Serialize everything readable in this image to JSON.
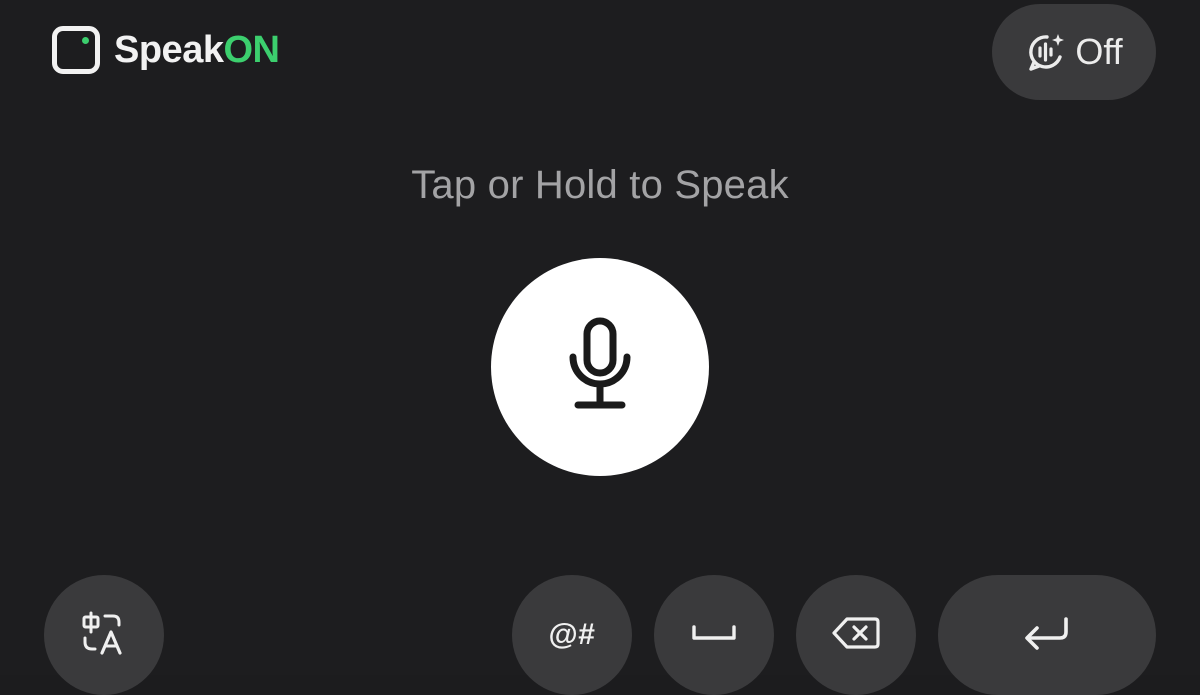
{
  "header": {
    "brand": {
      "name_part1": "Speak",
      "name_part2": "ON",
      "accent_color": "#3ccf6e",
      "logo_icon": "rounded-square-logo-icon"
    },
    "toggle": {
      "icon": "voice-assist-icon",
      "label": "Off"
    }
  },
  "main": {
    "prompt": "Tap or Hold to Speak",
    "mic_icon": "microphone-icon"
  },
  "keys": [
    {
      "name": "language-switch",
      "icon": "translate-icon"
    },
    {
      "name": "symbols",
      "label": "@#"
    },
    {
      "name": "space",
      "icon": "space-icon"
    },
    {
      "name": "delete",
      "icon": "backspace-icon"
    },
    {
      "name": "enter",
      "icon": "return-icon"
    }
  ],
  "colors": {
    "background": "#1d1d1f",
    "key": "#3a3a3c",
    "text_muted": "#a3a3a5",
    "text": "#f2f2f2"
  }
}
